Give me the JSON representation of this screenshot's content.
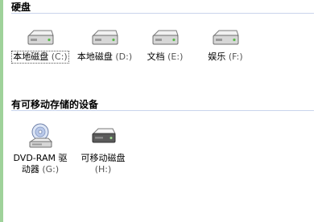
{
  "groups": [
    {
      "title": "硬盘",
      "items": [
        {
          "name": "本地磁盘",
          "drive": "(C:)"
        },
        {
          "name": "本地磁盘",
          "drive": "(D:)"
        },
        {
          "name": "文档",
          "drive": "(E:)"
        },
        {
          "name": "娱乐",
          "drive": "(F:)"
        }
      ]
    },
    {
      "title": "有可移动存储的设备",
      "items": [
        {
          "name": "DVD-RAM 驱动器",
          "drive": "(G:)"
        },
        {
          "name": "可移动磁盘",
          "drive": "(H:)"
        }
      ]
    }
  ],
  "selected_index": 0,
  "icons": {
    "hdd": "hard-drive-icon",
    "dvd": "dvd-drive-icon",
    "removable": "removable-disk-icon"
  }
}
